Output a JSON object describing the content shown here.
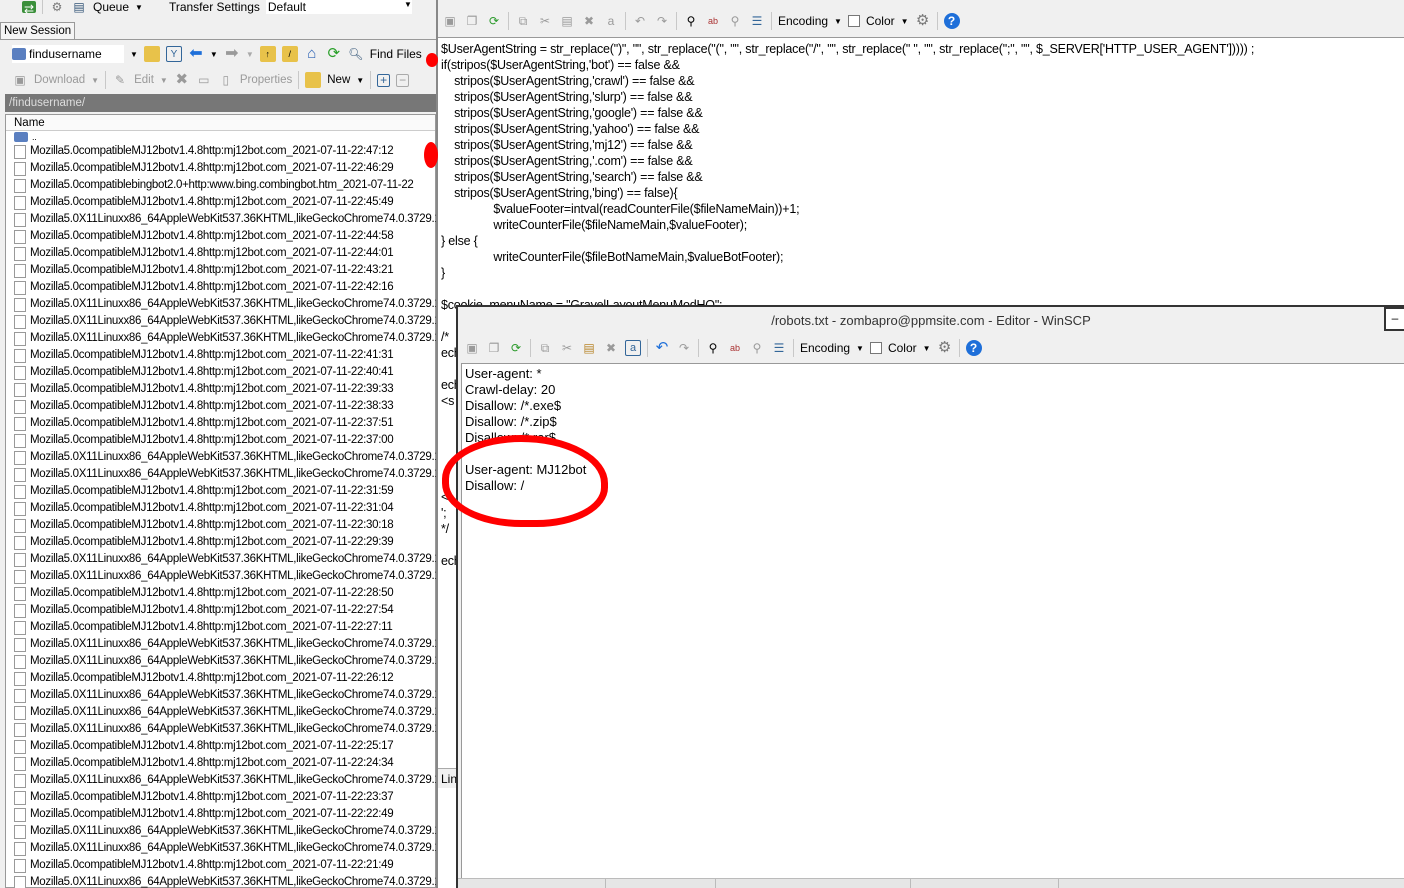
{
  "left": {
    "queue_label": "Queue",
    "transfer_settings_label": "Transfer Settings",
    "transfer_settings_value": "Default",
    "session_tab": "New Session",
    "path_dropdown": "findusername",
    "find_files": "Find Files",
    "download": "Download",
    "edit": "Edit",
    "properties": "Properties",
    "new": "New",
    "path": "/findusername/",
    "column_name": "Name",
    "parent": "..",
    "files": [
      "Mozilla5.0compatibleMJ12botv1.4.8http:mj12bot.com_2021-07-11-22:47:12",
      "Mozilla5.0compatibleMJ12botv1.4.8http:mj12bot.com_2021-07-11-22:46:29",
      "Mozilla5.0compatiblebingbot2.0+http:www.bing.combingbot.htm_2021-07-11-22",
      "Mozilla5.0compatibleMJ12botv1.4.8http:mj12bot.com_2021-07-11-22:45:49",
      "Mozilla5.0X11Linuxx86_64AppleWebKit537.36KHTML,likeGeckoChrome74.0.3729.13",
      "Mozilla5.0compatibleMJ12botv1.4.8http:mj12bot.com_2021-07-11-22:44:58",
      "Mozilla5.0compatibleMJ12botv1.4.8http:mj12bot.com_2021-07-11-22:44:01",
      "Mozilla5.0compatibleMJ12botv1.4.8http:mj12bot.com_2021-07-11-22:43:21",
      "Mozilla5.0compatibleMJ12botv1.4.8http:mj12bot.com_2021-07-11-22:42:16",
      "Mozilla5.0X11Linuxx86_64AppleWebKit537.36KHTML,likeGeckoChrome74.0.3729.13",
      "Mozilla5.0X11Linuxx86_64AppleWebKit537.36KHTML,likeGeckoChrome74.0.3729.13",
      "Mozilla5.0X11Linuxx86_64AppleWebKit537.36KHTML,likeGeckoChrome74.0.3729.13",
      "Mozilla5.0compatibleMJ12botv1.4.8http:mj12bot.com_2021-07-11-22:41:31",
      "Mozilla5.0compatibleMJ12botv1.4.8http:mj12bot.com_2021-07-11-22:40:41",
      "Mozilla5.0compatibleMJ12botv1.4.8http:mj12bot.com_2021-07-11-22:39:33",
      "Mozilla5.0compatibleMJ12botv1.4.8http:mj12bot.com_2021-07-11-22:38:33",
      "Mozilla5.0compatibleMJ12botv1.4.8http:mj12bot.com_2021-07-11-22:37:51",
      "Mozilla5.0compatibleMJ12botv1.4.8http:mj12bot.com_2021-07-11-22:37:00",
      "Mozilla5.0X11Linuxx86_64AppleWebKit537.36KHTML,likeGeckoChrome74.0.3729.13",
      "Mozilla5.0X11Linuxx86_64AppleWebKit537.36KHTML,likeGeckoChrome74.0.3729.13",
      "Mozilla5.0compatibleMJ12botv1.4.8http:mj12bot.com_2021-07-11-22:31:59",
      "Mozilla5.0compatibleMJ12botv1.4.8http:mj12bot.com_2021-07-11-22:31:04",
      "Mozilla5.0compatibleMJ12botv1.4.8http:mj12bot.com_2021-07-11-22:30:18",
      "Mozilla5.0compatibleMJ12botv1.4.8http:mj12bot.com_2021-07-11-22:29:39",
      "Mozilla5.0X11Linuxx86_64AppleWebKit537.36KHTML,likeGeckoChrome74.0.3729.13",
      "Mozilla5.0X11Linuxx86_64AppleWebKit537.36KHTML,likeGeckoChrome74.0.3729.13",
      "Mozilla5.0compatibleMJ12botv1.4.8http:mj12bot.com_2021-07-11-22:28:50",
      "Mozilla5.0compatibleMJ12botv1.4.8http:mj12bot.com_2021-07-11-22:27:54",
      "Mozilla5.0compatibleMJ12botv1.4.8http:mj12bot.com_2021-07-11-22:27:11",
      "Mozilla5.0X11Linuxx86_64AppleWebKit537.36KHTML,likeGeckoChrome74.0.3729.13",
      "Mozilla5.0X11Linuxx86_64AppleWebKit537.36KHTML,likeGeckoChrome74.0.3729.13",
      "Mozilla5.0compatibleMJ12botv1.4.8http:mj12bot.com_2021-07-11-22:26:12",
      "Mozilla5.0X11Linuxx86_64AppleWebKit537.36KHTML,likeGeckoChrome74.0.3729.13",
      "Mozilla5.0X11Linuxx86_64AppleWebKit537.36KHTML,likeGeckoChrome74.0.3729.13",
      "Mozilla5.0X11Linuxx86_64AppleWebKit537.36KHTML,likeGeckoChrome74.0.3729.13",
      "Mozilla5.0compatibleMJ12botv1.4.8http:mj12bot.com_2021-07-11-22:25:17",
      "Mozilla5.0compatibleMJ12botv1.4.8http:mj12bot.com_2021-07-11-22:24:34",
      "Mozilla5.0X11Linuxx86_64AppleWebKit537.36KHTML,likeGeckoChrome74.0.3729.13",
      "Mozilla5.0compatibleMJ12botv1.4.8http:mj12bot.com_2021-07-11-22:23:37",
      "Mozilla5.0compatibleMJ12botv1.4.8http:mj12bot.com_2021-07-11-22:22:49",
      "Mozilla5.0X11Linuxx86_64AppleWebKit537.36KHTML,likeGeckoChrome74.0.3729.13",
      "Mozilla5.0X11Linuxx86_64AppleWebKit537.36KHTML,likeGeckoChrome74.0.3729.13",
      "Mozilla5.0compatibleMJ12botv1.4.8http:mj12bot.com_2021-07-11-22:21:49",
      "Mozilla5.0X11Linuxx86_64AppleWebKit537.36KHTML,likeGeckoChrome74.0.3729.13"
    ]
  },
  "back_editor": {
    "encoding": "Encoding",
    "color": "Color",
    "lines": [
      "$UserAgentString = str_replace(\")\", \"\", str_replace(\"(\", \"\", str_replace(\"/\", \"\", str_replace(\" \", \"\", str_replace(\";\", \"\", $_SERVER['HTTP_USER_AGENT'])))) ;",
      "if(stripos($UserAgentString,'bot') == false &&",
      "    stripos($UserAgentString,'crawl') == false &&",
      "    stripos($UserAgentString,'slurp') == false &&",
      "    stripos($UserAgentString,'google') == false &&",
      "    stripos($UserAgentString,'yahoo') == false &&",
      "    stripos($UserAgentString,'mj12') == false &&",
      "    stripos($UserAgentString,'.com') == false &&",
      "    stripos($UserAgentString,'search') == false &&",
      "    stripos($UserAgentString,'bing') == false){",
      "                $valueFooter=intval(readCounterFile($fileNameMain))+1;",
      "                writeCounterFile($fileNameMain,$valueFooter);",
      "} else {",
      "                writeCounterFile($fileBotNameMain,$valueBotFooter);",
      "}",
      "",
      "$cookie_menuName = \"GravelLayoutMenuModHQ\";",
      "",
      "/*",
      "ech",
      "",
      "ech",
      "<s",
      "",
      "",
      "",
      "",
      "",
      "<",
      "';",
      "*/",
      "",
      "ech"
    ],
    "status_stub": "Lin"
  },
  "front_editor": {
    "title": "/robots.txt - zombapro@ppmsite.com - Editor - WinSCP",
    "encoding": "Encoding",
    "color": "Color",
    "lines": [
      "User-agent: *",
      "Crawl-delay: 20",
      "Disallow: /*.exe$",
      "Disallow: /*.zip$",
      "Disallow: /*.rar$",
      "",
      "User-agent: MJ12bot",
      "Disallow: /"
    ]
  },
  "colors": {
    "annotation": "#ff0000",
    "path_bar": "#777777"
  }
}
